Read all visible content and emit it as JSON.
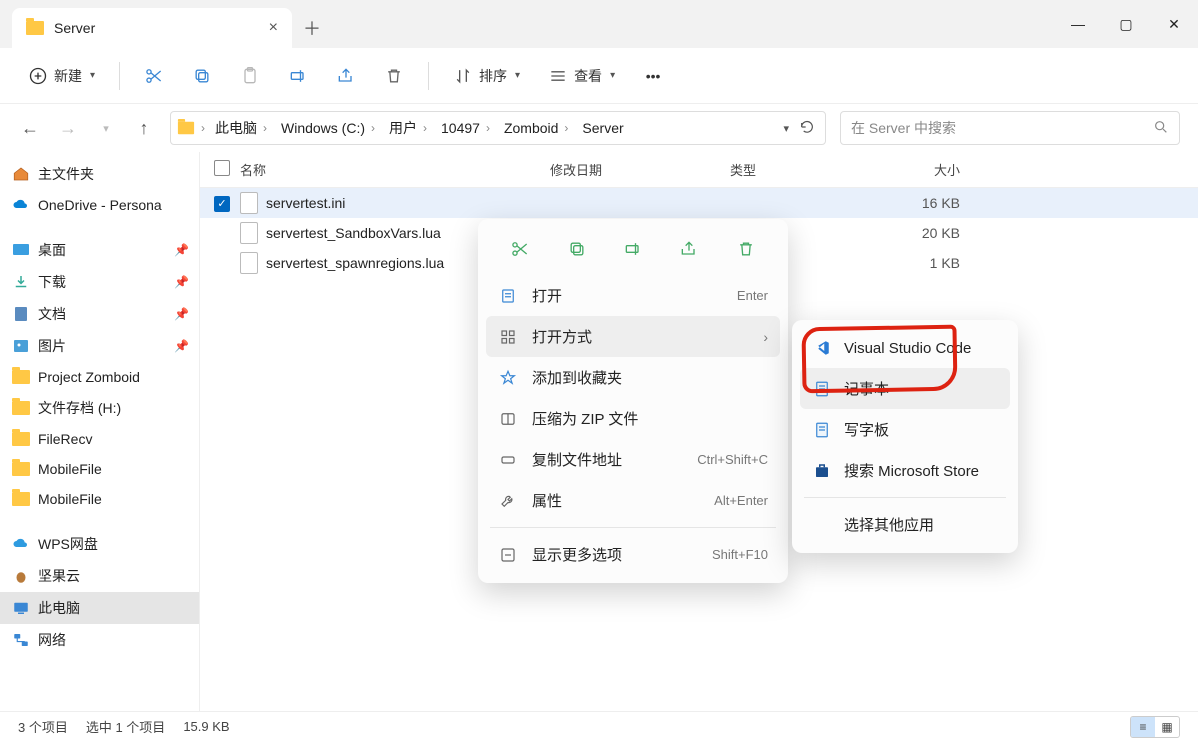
{
  "window": {
    "tab_title": "Server",
    "sort_label": "排序",
    "view_label": "查看",
    "new_label": "新建"
  },
  "breadcrumbs": [
    "此电脑",
    "Windows (C:)",
    "用户",
    "10497",
    "Zomboid",
    "Server"
  ],
  "search": {
    "placeholder": "在 Server 中搜索"
  },
  "columns": {
    "name": "名称",
    "date": "修改日期",
    "type": "类型",
    "size": "大小"
  },
  "sidebar": {
    "home": "主文件夹",
    "onedrive": "OneDrive - Persona",
    "quick": [
      {
        "label": "桌面",
        "pin": true
      },
      {
        "label": "下载",
        "pin": true
      },
      {
        "label": "文档",
        "pin": true
      },
      {
        "label": "图片",
        "pin": true
      },
      {
        "label": "Project Zomboid",
        "pin": false
      },
      {
        "label": "文件存档 (H:)",
        "pin": false
      },
      {
        "label": "FileRecv",
        "pin": false
      },
      {
        "label": "MobileFile",
        "pin": false
      },
      {
        "label": "MobileFile",
        "pin": false
      }
    ],
    "wps": "WPS网盘",
    "nut": "坚果云",
    "pc": "此电脑",
    "net": "网络"
  },
  "files": [
    {
      "name": "servertest.ini",
      "size": "16 KB",
      "selected": true
    },
    {
      "name": "servertest_SandboxVars.lua",
      "size": "20 KB",
      "selected": false
    },
    {
      "name": "servertest_spawnregions.lua",
      "size": "1 KB",
      "selected": false
    }
  ],
  "context_menu": {
    "open": "打开",
    "open_kbd": "Enter",
    "open_with": "打开方式",
    "favorite": "添加到收藏夹",
    "zip": "压缩为 ZIP 文件",
    "copy_path": "复制文件地址",
    "copy_path_kbd": "Ctrl+Shift+C",
    "properties": "属性",
    "properties_kbd": "Alt+Enter",
    "more": "显示更多选项",
    "more_kbd": "Shift+F10"
  },
  "open_with_menu": {
    "vscode": "Visual Studio Code",
    "notepad": "记事本",
    "wordpad": "写字板",
    "store": "搜索 Microsoft Store",
    "choose": "选择其他应用"
  },
  "status": {
    "items": "3 个项目",
    "selected": "选中 1 个项目",
    "size": "15.9 KB"
  }
}
